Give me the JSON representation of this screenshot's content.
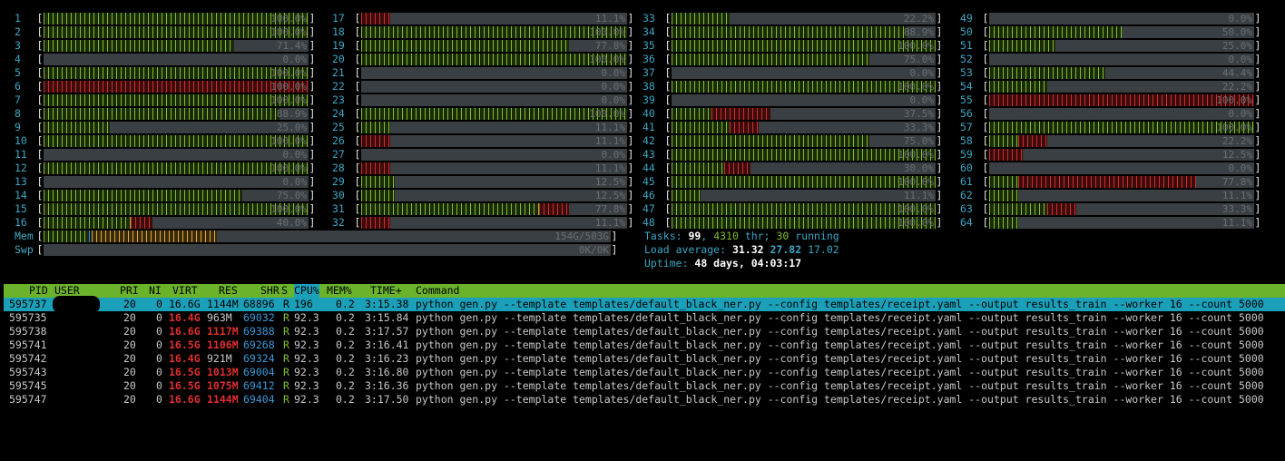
{
  "cpus": [
    {
      "id": "1",
      "pct": "100.0%",
      "g": 1.0,
      "r": 0
    },
    {
      "id": "2",
      "pct": "100.0%",
      "g": 1.0,
      "r": 0
    },
    {
      "id": "3",
      "pct": "71.4%",
      "g": 0.72,
      "r": 0
    },
    {
      "id": "4",
      "pct": "0.0%",
      "g": 0,
      "r": 0
    },
    {
      "id": "5",
      "pct": "100.0%",
      "g": 1.0,
      "r": 0
    },
    {
      "id": "6",
      "pct": "100.0%",
      "g": 0,
      "r": 1.0
    },
    {
      "id": "7",
      "pct": "100.0%",
      "g": 1.0,
      "r": 0
    },
    {
      "id": "8",
      "pct": "88.9%",
      "g": 0.89,
      "r": 0
    },
    {
      "id": "9",
      "pct": "25.0%",
      "g": 0.25,
      "r": 0
    },
    {
      "id": "10",
      "pct": "100.0%",
      "g": 1.0,
      "r": 0
    },
    {
      "id": "11",
      "pct": "0.0%",
      "g": 0,
      "r": 0
    },
    {
      "id": "12",
      "pct": "100.0%",
      "g": 1.0,
      "r": 0
    },
    {
      "id": "13",
      "pct": "0.0%",
      "g": 0,
      "r": 0
    },
    {
      "id": "14",
      "pct": "75.0%",
      "g": 0.75,
      "r": 0
    },
    {
      "id": "15",
      "pct": "100.0%",
      "g": 1.0,
      "r": 0
    },
    {
      "id": "16",
      "pct": "40.0%",
      "g": 0.33,
      "r": 0.08
    },
    {
      "id": "17",
      "pct": "11.1%",
      "g": 0,
      "r": 0.11
    },
    {
      "id": "18",
      "pct": "100.0%",
      "g": 1.0,
      "r": 0
    },
    {
      "id": "19",
      "pct": "77.8%",
      "g": 0.78,
      "r": 0
    },
    {
      "id": "20",
      "pct": "100.0%",
      "g": 1.0,
      "r": 0
    },
    {
      "id": "21",
      "pct": "0.0%",
      "g": 0,
      "r": 0
    },
    {
      "id": "22",
      "pct": "0.0%",
      "g": 0,
      "r": 0
    },
    {
      "id": "23",
      "pct": "0.0%",
      "g": 0,
      "r": 0
    },
    {
      "id": "24",
      "pct": "100.0%",
      "g": 1.0,
      "r": 0
    },
    {
      "id": "25",
      "pct": "11.1%",
      "g": 0.11,
      "r": 0
    },
    {
      "id": "26",
      "pct": "11.1%",
      "g": 0,
      "r": 0.11
    },
    {
      "id": "27",
      "pct": "0.0%",
      "g": 0,
      "r": 0
    },
    {
      "id": "28",
      "pct": "11.1%",
      "g": 0,
      "r": 0.11
    },
    {
      "id": "29",
      "pct": "12.5%",
      "g": 0.125,
      "r": 0
    },
    {
      "id": "30",
      "pct": "12.5%",
      "g": 0.125,
      "r": 0
    },
    {
      "id": "31",
      "pct": "77.8%",
      "g": 0.67,
      "r": 0.11
    },
    {
      "id": "32",
      "pct": "11.1%",
      "g": 0,
      "r": 0.11
    },
    {
      "id": "33",
      "pct": "22.2%",
      "g": 0.22,
      "r": 0
    },
    {
      "id": "34",
      "pct": "88.9%",
      "g": 0.89,
      "r": 0
    },
    {
      "id": "35",
      "pct": "100.0%",
      "g": 1.0,
      "r": 0
    },
    {
      "id": "36",
      "pct": "75.0%",
      "g": 0.75,
      "r": 0
    },
    {
      "id": "37",
      "pct": "0.0%",
      "g": 0,
      "r": 0
    },
    {
      "id": "38",
      "pct": "100.0%",
      "g": 1.0,
      "r": 0
    },
    {
      "id": "39",
      "pct": "0.0%",
      "g": 0,
      "r": 0
    },
    {
      "id": "40",
      "pct": "37.5%",
      "g": 0.15,
      "r": 0.225
    },
    {
      "id": "41",
      "pct": "33.3%",
      "g": 0.22,
      "r": 0.11
    },
    {
      "id": "42",
      "pct": "75.0%",
      "g": 0.75,
      "r": 0
    },
    {
      "id": "43",
      "pct": "100.0%",
      "g": 1.0,
      "r": 0
    },
    {
      "id": "44",
      "pct": "30.0%",
      "g": 0.2,
      "r": 0.1
    },
    {
      "id": "45",
      "pct": "100.0%",
      "g": 1.0,
      "r": 0
    },
    {
      "id": "46",
      "pct": "11.1%",
      "g": 0.11,
      "r": 0
    },
    {
      "id": "47",
      "pct": "100.0%",
      "g": 1.0,
      "r": 0
    },
    {
      "id": "48",
      "pct": "100.0%",
      "g": 1.0,
      "r": 0
    },
    {
      "id": "49",
      "pct": "0.0%",
      "g": 0,
      "r": 0
    },
    {
      "id": "50",
      "pct": "50.0%",
      "g": 0.5,
      "r": 0
    },
    {
      "id": "51",
      "pct": "25.0%",
      "g": 0.25,
      "r": 0
    },
    {
      "id": "52",
      "pct": "0.0%",
      "g": 0,
      "r": 0
    },
    {
      "id": "53",
      "pct": "44.4%",
      "g": 0.44,
      "r": 0
    },
    {
      "id": "54",
      "pct": "22.2%",
      "g": 0.22,
      "r": 0
    },
    {
      "id": "55",
      "pct": "100.0%",
      "g": 0,
      "r": 1.0
    },
    {
      "id": "56",
      "pct": "0.0%",
      "g": 0,
      "r": 0
    },
    {
      "id": "57",
      "pct": "100.0%",
      "g": 1.0,
      "r": 0
    },
    {
      "id": "58",
      "pct": "22.2%",
      "g": 0.11,
      "r": 0.11
    },
    {
      "id": "59",
      "pct": "12.5%",
      "g": 0,
      "r": 0.125
    },
    {
      "id": "60",
      "pct": "0.0%",
      "g": 0,
      "r": 0
    },
    {
      "id": "61",
      "pct": "77.8%",
      "g": 0.11,
      "r": 0.67
    },
    {
      "id": "62",
      "pct": "11.1%",
      "g": 0.11,
      "r": 0
    },
    {
      "id": "63",
      "pct": "33.3%",
      "g": 0.22,
      "r": 0.11
    },
    {
      "id": "64",
      "pct": "11.1%",
      "g": 0.11,
      "r": 0
    }
  ],
  "mem": {
    "label": "Mem",
    "value": "154G/503G",
    "g": 0.08,
    "b": 0.005,
    "o": 0.22
  },
  "swp": {
    "label": "Swp",
    "value": "0K/0K"
  },
  "tasks": {
    "label": "Tasks: ",
    "count": "99",
    "sep1": ", ",
    "thr": "4310",
    "thr_label": " thr; ",
    "running": "30",
    "running_label": " running"
  },
  "load": {
    "label": "Load average: ",
    "l1": "31.32",
    "l5": "27.82",
    "l15": "17.02"
  },
  "uptime": {
    "label": "Uptime: ",
    "value": "48 days, 04:03:17"
  },
  "columns": {
    "pid": "PID",
    "user": "USER",
    "pri": "PRI",
    "ni": "NI",
    "virt": "VIRT",
    "res": "RES",
    "shr": "SHR",
    "s": "S",
    "cpu": "CPU%",
    "mem": "MEM%",
    "time": "TIME+",
    "command": "Command"
  },
  "processes": [
    {
      "pid": "595737",
      "pri": "20",
      "ni": "0",
      "virt": "16.6G",
      "res": "1144M",
      "shr": "68896",
      "s": "R",
      "cpu": "196",
      "mem": "0.2",
      "time": "3:15.38",
      "command": "python gen.py --template templates/default_black_ner.py --config templates/receipt.yaml --output results_train --worker 16 --count 5000",
      "selected": true
    },
    {
      "pid": "595735",
      "pri": "20",
      "ni": "0",
      "virt": "16.4G",
      "res": "963M",
      "shr": "69032",
      "s": "R",
      "cpu": "92.3",
      "mem": "0.2",
      "time": "3:15.84",
      "command": "python gen.py --template templates/default_black_ner.py --config templates/receipt.yaml --output results_train --worker 16 --count 5000"
    },
    {
      "pid": "595738",
      "pri": "20",
      "ni": "0",
      "virt": "16.6G",
      "res": "1117M",
      "shr": "69388",
      "s": "R",
      "cpu": "92.3",
      "mem": "0.2",
      "time": "3:17.57",
      "command": "python gen.py --template templates/default_black_ner.py --config templates/receipt.yaml --output results_train --worker 16 --count 5000"
    },
    {
      "pid": "595741",
      "pri": "20",
      "ni": "0",
      "virt": "16.5G",
      "res": "1106M",
      "shr": "69268",
      "s": "R",
      "cpu": "92.3",
      "mem": "0.2",
      "time": "3:16.41",
      "command": "python gen.py --template templates/default_black_ner.py --config templates/receipt.yaml --output results_train --worker 16 --count 5000"
    },
    {
      "pid": "595742",
      "pri": "20",
      "ni": "0",
      "virt": "16.4G",
      "res": "921M",
      "shr": "69324",
      "s": "R",
      "cpu": "92.3",
      "mem": "0.2",
      "time": "3:16.23",
      "command": "python gen.py --template templates/default_black_ner.py --config templates/receipt.yaml --output results_train --worker 16 --count 5000"
    },
    {
      "pid": "595743",
      "pri": "20",
      "ni": "0",
      "virt": "16.5G",
      "res": "1013M",
      "shr": "69004",
      "s": "R",
      "cpu": "92.3",
      "mem": "0.2",
      "time": "3:16.80",
      "command": "python gen.py --template templates/default_black_ner.py --config templates/receipt.yaml --output results_train --worker 16 --count 5000"
    },
    {
      "pid": "595745",
      "pri": "20",
      "ni": "0",
      "virt": "16.5G",
      "res": "1075M",
      "shr": "69412",
      "s": "R",
      "cpu": "92.3",
      "mem": "0.2",
      "time": "3:16.36",
      "command": "python gen.py --template templates/default_black_ner.py --config templates/receipt.yaml --output results_train --worker 16 --count 5000"
    },
    {
      "pid": "595747",
      "pri": "20",
      "ni": "0",
      "virt": "16.6G",
      "res": "1144M",
      "shr": "69404",
      "s": "R",
      "cpu": "92.3",
      "mem": "0.2",
      "time": "3:17.50",
      "command": "python gen.py --template templates/default_black_ner.py --config templates/receipt.yaml --output results_train --worker 16 --count 5000"
    }
  ]
}
